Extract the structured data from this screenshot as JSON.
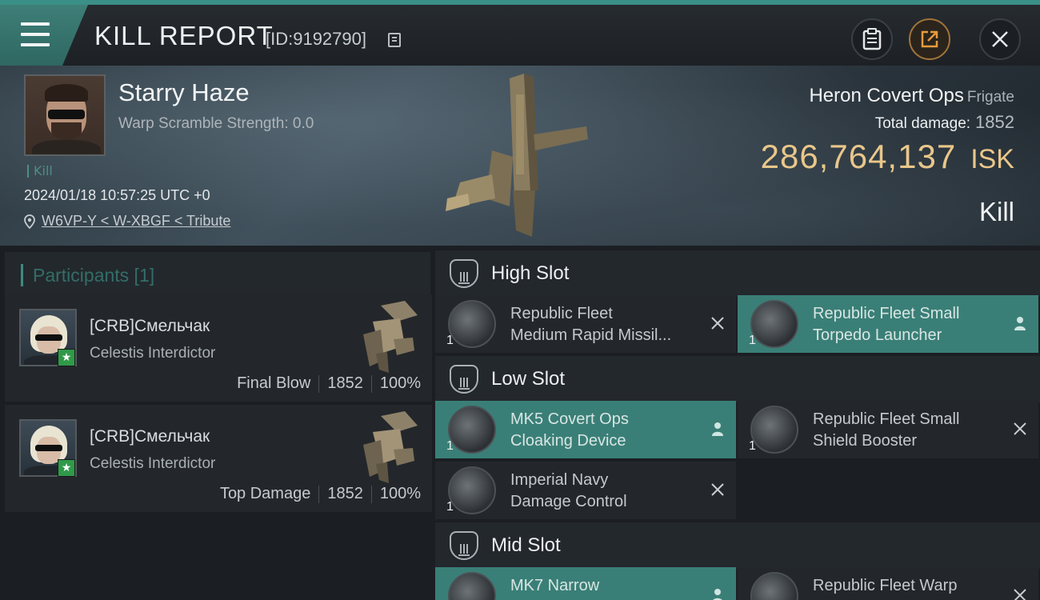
{
  "header": {
    "title": "KILL REPORT",
    "report_id": "[ID:9192790]"
  },
  "victim": {
    "name": "Starry Haze",
    "warp_scramble": "Warp Scramble Strength: 0.0",
    "kill_tag": "Kill",
    "datetime": "2024/01/18 10:57:25 UTC +0",
    "location": "W6VP-Y < W-XBGF < Tribute",
    "ship_name": "Heron Covert Ops",
    "ship_class": "Frigate",
    "total_damage_label": "Total damage:",
    "total_damage": "1852",
    "isk_value": "286,764,137",
    "isk_unit": "ISK",
    "result": "Kill"
  },
  "participants": {
    "label": "Participants [1]",
    "items": [
      {
        "name": "[CRB]Смельчак",
        "ship": "Celestis Interdictor",
        "role": "Final Blow",
        "damage": "1852",
        "percent": "100%"
      },
      {
        "name": "[CRB]Смельчак",
        "ship": "Celestis Interdictor",
        "role": "Top Damage",
        "damage": "1852",
        "percent": "100%"
      }
    ]
  },
  "fitting": {
    "high_slot": {
      "title": "High Slot",
      "modules": [
        {
          "name_line1": "Republic Fleet",
          "name_line2": "Medium Rapid Missil...",
          "qty": "1",
          "status": "x"
        },
        {
          "name_line1": "Republic Fleet Small",
          "name_line2": "Torpedo Launcher",
          "qty": "1",
          "status": "pilot"
        }
      ]
    },
    "low_slot": {
      "title": "Low Slot",
      "modules": [
        {
          "name_line1": "MK5 Covert Ops",
          "name_line2": "Cloaking Device",
          "qty": "1",
          "status": "pilot"
        },
        {
          "name_line1": "Republic Fleet Small",
          "name_line2": "Shield Booster",
          "qty": "1",
          "status": "x"
        },
        {
          "name_line1": "Imperial Navy",
          "name_line2": "Damage Control",
          "qty": "1",
          "status": "x"
        }
      ]
    },
    "mid_slot": {
      "title": "Mid Slot",
      "modules": [
        {
          "name_line1": "MK7 Narrow",
          "name_line2": "",
          "qty": "",
          "status": "pilot"
        },
        {
          "name_line1": "Republic Fleet Warp",
          "name_line2": "",
          "qty": "",
          "status": "x"
        }
      ]
    }
  },
  "colors": {
    "accent_teal": "#3a7f77",
    "isk_gold": "#e9c78a",
    "final_blow_badge": "#2f9a49"
  }
}
